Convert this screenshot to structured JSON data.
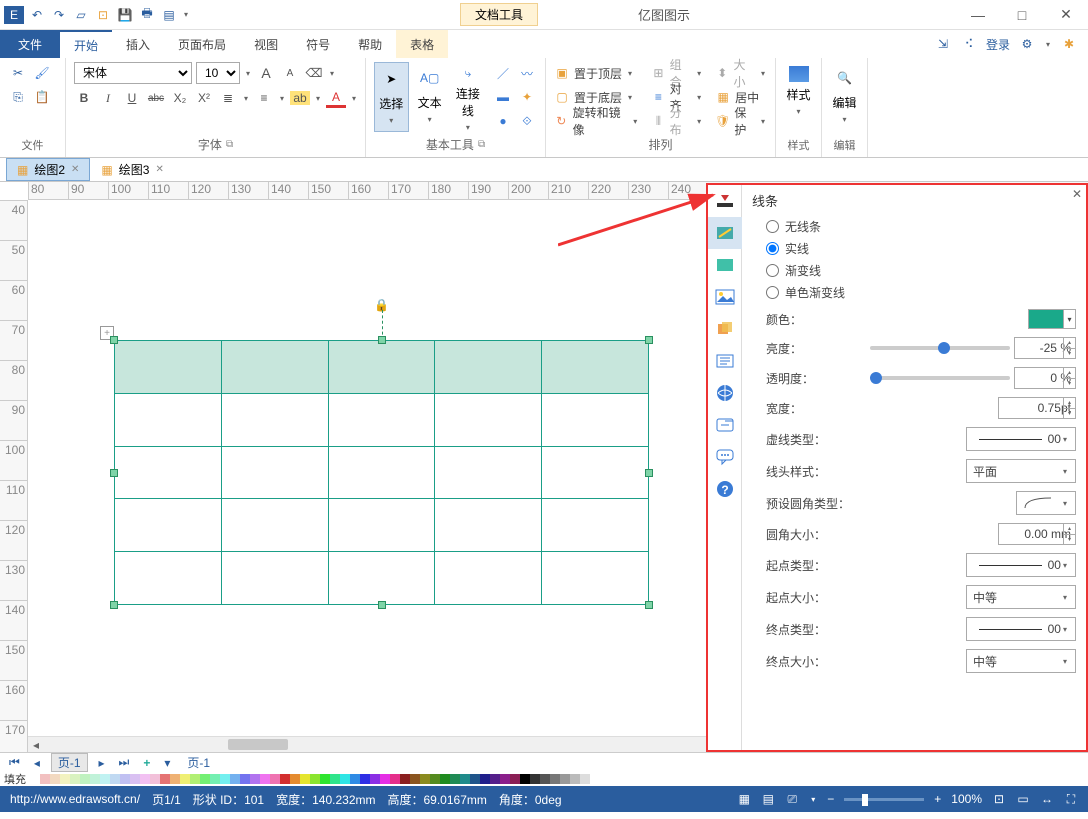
{
  "app": {
    "contextual_group": "文档工具",
    "contextual_tab": "表格",
    "title": "亿图图示"
  },
  "menu": {
    "file": "文件",
    "tabs": [
      "开始",
      "插入",
      "页面布局",
      "视图",
      "符号",
      "帮助"
    ],
    "login": "登录"
  },
  "ribbon": {
    "group_file": "文件",
    "group_font": "字体",
    "font_name": "宋体",
    "font_size": "10",
    "bold": "B",
    "italic": "I",
    "underline": "U",
    "strike": "abc",
    "group_basic": "基本工具",
    "select": "选择",
    "text": "文本",
    "connector": "连接线",
    "group_arrange": "排列",
    "top": "置于顶层",
    "bottom": "置于底层",
    "rotate": "旋转和镜像",
    "group_btn": "组合",
    "align": "对齐",
    "distribute": "分布",
    "size": "大小",
    "center": "居中",
    "protect": "保护",
    "group_style": "样式",
    "style": "样式",
    "group_edit": "编辑",
    "edit": "编辑"
  },
  "doc_tabs": [
    {
      "label": "绘图2",
      "active": true
    },
    {
      "label": "绘图3",
      "active": false
    }
  ],
  "ruler_h": [
    "80",
    "90",
    "100",
    "110",
    "120",
    "130",
    "140",
    "150",
    "160",
    "170",
    "180",
    "190",
    "200",
    "210",
    "220",
    "230",
    "240"
  ],
  "ruler_v": [
    "40",
    "50",
    "60",
    "70",
    "80",
    "90",
    "100",
    "110",
    "120",
    "130",
    "140",
    "150",
    "160",
    "170"
  ],
  "panel": {
    "title": "线条",
    "opt_none": "无线条",
    "opt_solid": "实线",
    "opt_grad": "渐变线",
    "opt_mono_grad": "单色渐变线",
    "color": "颜色：",
    "brightness": "亮度：",
    "brightness_val": "-25 %",
    "opacity": "透明度：",
    "opacity_val": "0 %",
    "width": "宽度：",
    "width_val": "0.75pt",
    "dash": "虚线类型：",
    "dash_val": "00",
    "cap": "线头样式：",
    "cap_val": "平面",
    "corner_preset": "预设圆角类型：",
    "corner": "圆角大小：",
    "corner_val": "0.00 mm",
    "start_type": "起点类型：",
    "start_type_val": "00",
    "start_size": "起点大小：",
    "start_size_val": "中等",
    "end_type": "终点类型：",
    "end_type_val": "00",
    "end_size": "终点大小：",
    "end_size_val": "中等"
  },
  "page_tabs": {
    "current": "页-1",
    "tab": "页-1",
    "add": "+"
  },
  "color_strip_label": "填充",
  "colors": [
    "#ffffff",
    "#f2c0c0",
    "#f2d9c0",
    "#f2f2c0",
    "#d9f2c0",
    "#c0f2c0",
    "#c0f2d9",
    "#c0f2f2",
    "#c0d9f2",
    "#c0c0f2",
    "#d9c0f2",
    "#f2c0f2",
    "#f2c0d9",
    "#e57373",
    "#efb173",
    "#efef73",
    "#b1ef73",
    "#73ef73",
    "#73efb1",
    "#73efef",
    "#73b1ef",
    "#7373ef",
    "#b173ef",
    "#ef73ef",
    "#ef73b1",
    "#d32f2f",
    "#e58b2f",
    "#e5e52f",
    "#8be52f",
    "#2fe52f",
    "#2fe58b",
    "#2fe5e5",
    "#2f8be5",
    "#2f2fe5",
    "#8b2fe5",
    "#e52fe5",
    "#e52f8b",
    "#8b1f1f",
    "#8b551f",
    "#8b8b1f",
    "#558b1f",
    "#1f8b1f",
    "#1f8b55",
    "#1f8b8b",
    "#1f558b",
    "#1f1f8b",
    "#551f8b",
    "#8b1f8b",
    "#8b1f55",
    "#000000",
    "#333333",
    "#555555",
    "#777777",
    "#999999",
    "#bbbbbb",
    "#dddddd",
    "#ffffff"
  ],
  "status": {
    "url": "http://www.edrawsoft.cn/",
    "page": "页1/1",
    "shape_id": "形状 ID：101",
    "width": "宽度：140.232mm",
    "height": "高度：69.0167mm",
    "angle": "角度：0deg",
    "zoom": "100%",
    "plus": "+",
    "minus": "−"
  }
}
